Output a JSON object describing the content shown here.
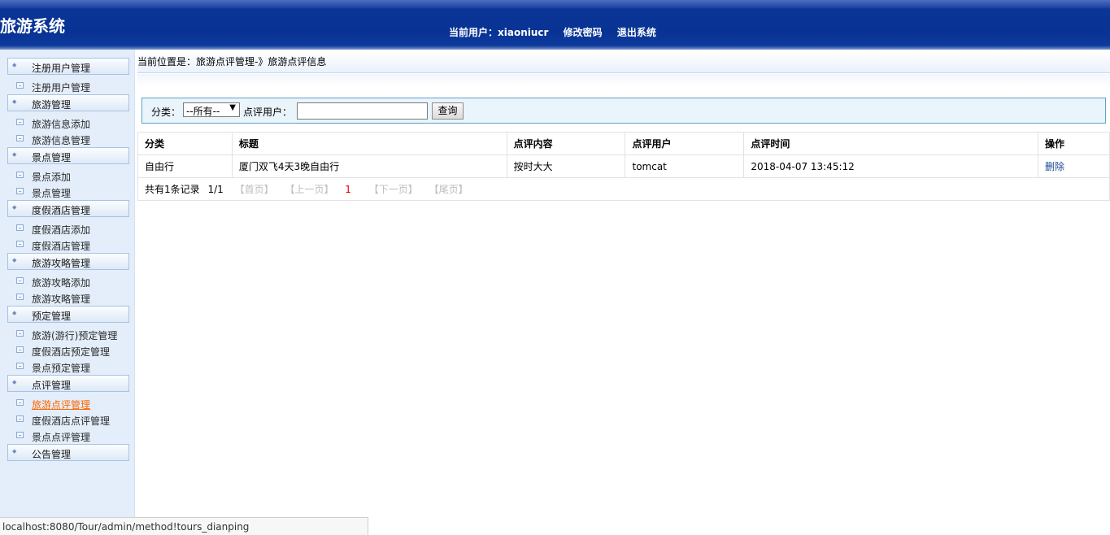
{
  "header": {
    "title": "旅游系统",
    "user_label": "当前用户：xiaoniucr",
    "change_password": "修改密码",
    "logout": "退出系统"
  },
  "sidebar": {
    "groups": [
      {
        "label": "注册用户管理",
        "items": [
          "注册用户管理"
        ]
      },
      {
        "label": "旅游管理",
        "items": [
          "旅游信息添加",
          "旅游信息管理"
        ]
      },
      {
        "label": "景点管理",
        "items": [
          "景点添加",
          "景点管理"
        ]
      },
      {
        "label": "度假酒店管理",
        "items": [
          "度假酒店添加",
          "度假酒店管理"
        ]
      },
      {
        "label": "旅游攻略管理",
        "items": [
          "旅游攻略添加",
          "旅游攻略管理"
        ]
      },
      {
        "label": "预定管理",
        "items": [
          "旅游(游行)预定管理",
          "度假酒店预定管理",
          "景点预定管理"
        ]
      },
      {
        "label": "点评管理",
        "items": [
          "旅游点评管理",
          "度假酒店点评管理",
          "景点点评管理"
        ]
      },
      {
        "label": "公告管理",
        "items": []
      }
    ],
    "active_item": "旅游点评管理"
  },
  "breadcrumb": "当前位置是：旅游点评管理-》旅游点评信息",
  "search": {
    "category_label": "分类：",
    "category_value": "--所有--",
    "user_label": "点评用户：",
    "user_value": "",
    "button": "查询"
  },
  "table": {
    "columns": [
      "分类",
      "标题",
      "点评内容",
      "点评用户",
      "点评时间",
      "操作"
    ],
    "rows": [
      {
        "category": "自由行",
        "title": "厦门双飞4天3晚自由行",
        "content": "按时大大",
        "user": "tomcat",
        "time": "2018-04-07 13:45:12",
        "action": "删除"
      }
    ]
  },
  "pager": {
    "summary": "共有1条记录",
    "page": "1/1",
    "first": "【首页】",
    "prev": "【上一页】",
    "current": "1",
    "next": "【下一页】",
    "last": "【尾页】"
  },
  "statusbar": "localhost:8080/Tour/admin/method!tours_dianping"
}
